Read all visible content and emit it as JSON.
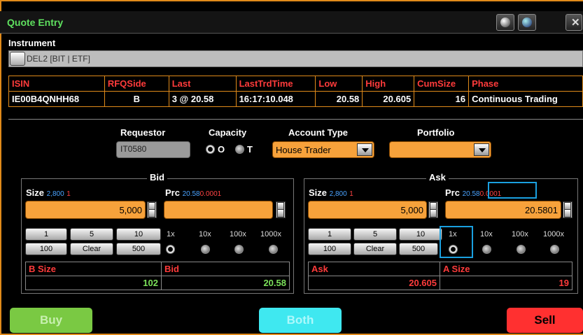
{
  "window": {
    "title": "Quote Entry"
  },
  "instrument": {
    "label": "Instrument",
    "value": "DEL2 [BIT | ETF]"
  },
  "quote_table": {
    "headers": [
      "ISIN",
      "RFQSide",
      "Last",
      "LastTrdTime",
      "Low",
      "High",
      "CumSize",
      "Phase"
    ],
    "row": [
      "IE00B4QNHH68",
      "B",
      "3 @ 20.58",
      "16:17:10.048",
      "20.58",
      "20.605",
      "16",
      "Continuous Trading"
    ]
  },
  "form": {
    "requestor_label": "Requestor",
    "requestor_value": "IT0580",
    "capacity_label": "Capacity",
    "capacity_o": "O",
    "capacity_t": "T",
    "account_type_label": "Account Type",
    "account_type_value": "House Trader",
    "portfolio_label": "Portfolio"
  },
  "bid": {
    "title": "Bid",
    "size_label": "Size",
    "size_hint": "2,800",
    "size_hint2": "1",
    "size_value": "5,000",
    "prc_label": "Prc",
    "prc_hint": "20.58",
    "prc_hint2": "0.0001",
    "prc_value": "",
    "keys_row1": [
      "1",
      "5",
      "10"
    ],
    "keys_row2": [
      "100",
      "Clear",
      "500"
    ],
    "mults": [
      "1x",
      "10x",
      "100x",
      "1000x"
    ],
    "col1_label": "B Size",
    "col2_label": "Bid",
    "col1_value": "102",
    "col2_value": "20.58"
  },
  "ask": {
    "title": "Ask",
    "size_label": "Size",
    "size_hint": "2,800",
    "size_hint2": "1",
    "size_value": "5,000",
    "prc_label": "Prc",
    "prc_hint": "20.58",
    "prc_hint2": "0.0001",
    "prc_value": "20.5801",
    "keys_row1": [
      "1",
      "5",
      "10"
    ],
    "keys_row2": [
      "100",
      "Clear",
      "500"
    ],
    "mults": [
      "1x",
      "10x",
      "100x",
      "1000x"
    ],
    "col1_label": "Ask",
    "col2_label": "A Size",
    "col1_value": "20.605",
    "col2_value": "19"
  },
  "actions": {
    "buy": "Buy",
    "both": "Both",
    "sell": "Sell"
  },
  "colors": {
    "orange": "#f7a23b",
    "green_title": "#5fe05f",
    "red_header": "#ff3b3b",
    "buy": "#7ac943",
    "both": "#3fe8f0",
    "sell": "#ff3030",
    "highlight": "#1aa0e0"
  }
}
